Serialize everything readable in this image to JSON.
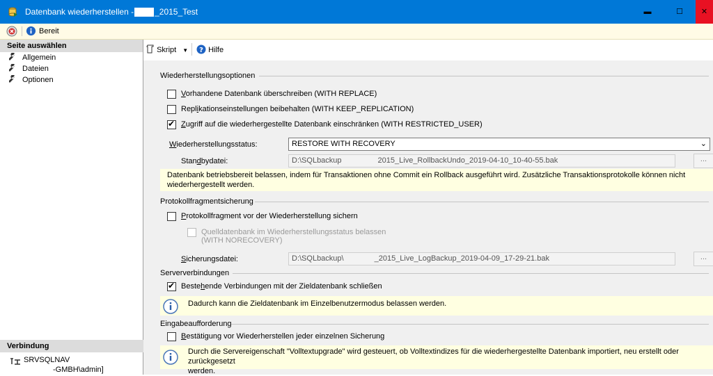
{
  "window": {
    "title_prefix": "Datenbank wiederherstellen -",
    "title_suffix": "_2015_Test",
    "buttons": {
      "minimize": "▬",
      "maximize": "☐",
      "close": "✕"
    }
  },
  "status": {
    "text": "Bereit"
  },
  "left": {
    "select_header": "Seite auswählen",
    "pages": [
      {
        "label": "Allgemein"
      },
      {
        "label": "Dateien"
      },
      {
        "label": "Optionen"
      }
    ],
    "connection_header": "Verbindung",
    "server": "SRVSQLNAV",
    "user": "-GMBH\\admin]"
  },
  "toolbar": {
    "script": "Skript",
    "help": "Hilfe"
  },
  "restore_options": {
    "header": "Wiederherstellungsoptionen",
    "overwrite": {
      "label_u": "V",
      "label": "orhandene Datenbank überschreiben (WITH REPLACE)",
      "checked": false
    },
    "keep_replication": {
      "label_pre": "Repl",
      "label_u": "i",
      "label": "kationseinstellungen beibehalten (WITH KEEP_REPLICATION)",
      "checked": false
    },
    "restrict_access": {
      "label_u": "Z",
      "label": "ugriff auf die wiederhergestellte Datenbank einschränken (WITH RESTRICTED_USER)",
      "checked": true
    },
    "state_label_u": "W",
    "state_label": "iederherstellungsstatus:",
    "state_value": "RESTORE WITH RECOVERY",
    "standby_label_pre": "Stan",
    "standby_label_u": "d",
    "standby_label": "bydatei:",
    "standby_value_pre": "D:\\SQLbackup",
    "standby_value_post": "2015_Live_RollbackUndo_2019-04-10_10-40-55.bak",
    "browse": "...",
    "notice_line1": "Datenbank betriebsbereit belassen, indem für Transaktionen ohne Commit ein Rollback ausgeführt wird. Zusätzliche Transaktionsprotokolle können nicht",
    "notice_line2": "wiederhergestellt werden."
  },
  "tail_log": {
    "header": "Protokollfragmentsicherung",
    "backup_tail": {
      "label_u": "P",
      "label": "rotokollfragment vor der Wiederherstellung sichern",
      "checked": false
    },
    "norecovery_line1": "Quelldatenbank im Wiederherstellungsstatus belassen",
    "norecovery_line2": "(WITH NORECOVERY)",
    "backup_file_label_u": "S",
    "backup_file_label": "icherungsdatei:",
    "backup_file_pre": "D:\\SQLbackup\\",
    "backup_file_post": "_2015_Live_LogBackup_2019-04-09_17-29-21.bak",
    "browse": "..."
  },
  "server_connections": {
    "header": "Serververbindungen",
    "close_existing": {
      "label_pre": "Beste",
      "label_u": "h",
      "label": "ende Verbindungen mit der Zieldatenbank schließen",
      "checked": true
    },
    "info": "Dadurch kann die Zieldatenbank im Einzelbenutzermodus belassen werden."
  },
  "prompt": {
    "header": "Eingabeaufforderung",
    "confirm": {
      "label_u": "B",
      "label": "estätigung vor Wiederherstellen jeder einzelnen Sicherung",
      "checked": false
    },
    "info_line1": "Durch die Servereigenschaft \"Volltextupgrade\" wird gesteuert, ob Volltextindizes für die wiederhergestellte Datenbank importiert, neu erstellt oder zurückgesetzt",
    "info_line2": "werden."
  },
  "colors": {
    "titlebar": "#0078d7",
    "close": "#e81123",
    "notice": "#ffffe1"
  }
}
